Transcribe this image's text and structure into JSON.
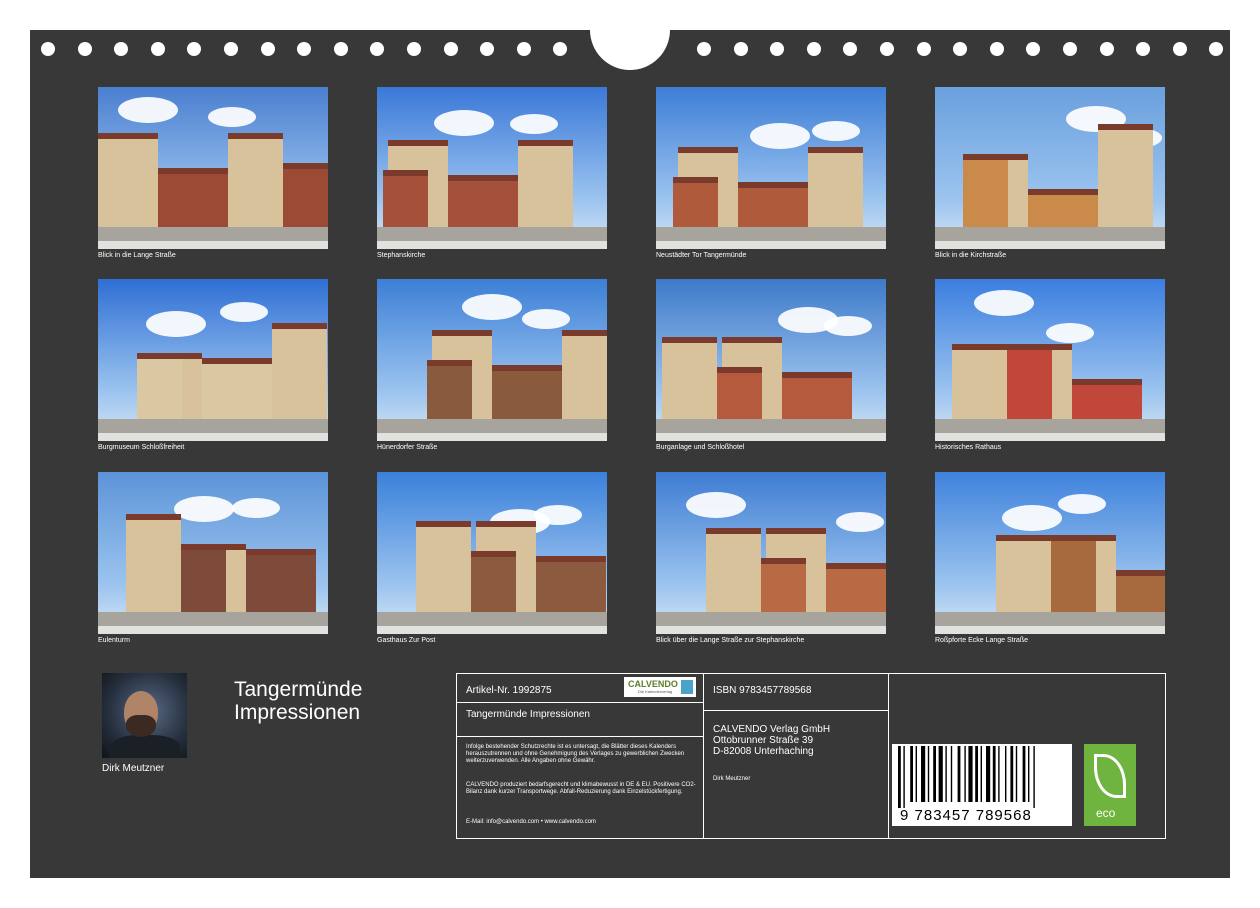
{
  "photos": [
    {
      "caption": "Blick in die Lange Straße",
      "sky": "#4a7fd0",
      "bld": "#9b4a35"
    },
    {
      "caption": "Stephanskirche",
      "sky": "#3a78d8",
      "bld": "#a5503a"
    },
    {
      "caption": "Neustädter Tor Tangermünde",
      "sky": "#3d7ed6",
      "bld": "#b05a3c"
    },
    {
      "caption": "Blick in die Kirchstraße",
      "sky": "#6aa0de",
      "bld": "#c98a4a"
    },
    {
      "caption": "Burgmuseum Schloßfreiheit",
      "sky": "#2f6fd4",
      "bld": "#d9c8a2"
    },
    {
      "caption": "Hünerdorfer Straße",
      "sky": "#3c7fd6",
      "bld": "#8a5a3c"
    },
    {
      "caption": "Burganlage und Schloßhotel",
      "sky": "#3e7ac9",
      "bld": "#b55a3d"
    },
    {
      "caption": "Historisches Rathaus",
      "sky": "#3b7ee0",
      "bld": "#c0473a"
    },
    {
      "caption": "Eulenturm",
      "sky": "#5c94d8",
      "bld": "#7e4a3a"
    },
    {
      "caption": "Gasthaus  Zur Post",
      "sky": "#3a80da",
      "bld": "#8c5a3e"
    },
    {
      "caption": "Blick über die Lange Straße zur Stephanskirche",
      "sky": "#3e7cd2",
      "bld": "#b76a44"
    },
    {
      "caption": "Roßpforte Ecke Lange Straße",
      "sky": "#3f82dc",
      "bld": "#a66a3e"
    }
  ],
  "author": "Dirk Meutzner",
  "title_line1": "Tangermünde",
  "title_line2": "Impressionen",
  "info": {
    "article": "Artikel-Nr. 1992875",
    "logo_word": "CALVENDO",
    "logo_sub": "Die Kalenderverlag",
    "product_title": "Tangermünde Impressionen",
    "legal": "Infolge bestehender Schutzrechte ist es untersagt, die Blätter dieses Kalenders herauszutrennen und ohne Genehmigung des Verlages zu gewerblichen Zwecken weiterzuverwenden. Alle Angaben ohne Gewähr.",
    "eco_note": "CALVENDO produziert bedarfsgerecht und klimabewusst in DE & EU. Positivere CO2-Bilanz dank kurzer Transportwege. Abfall-Reduzierung dank Einzelstückfertigung.",
    "contact": "E-Mail: info@calvendo.com • www.calvendo.com",
    "isbn": "ISBN 9783457789568",
    "publisher_line1": "CALVENDO Verlag GmbH",
    "publisher_line2": "Ottobrunner Straße 39",
    "publisher_line3": "D-82008 Unterhaching",
    "author_small": "Dirk Meutzner",
    "barcode_number": "9 783457 789568",
    "eco_label": "eco"
  }
}
